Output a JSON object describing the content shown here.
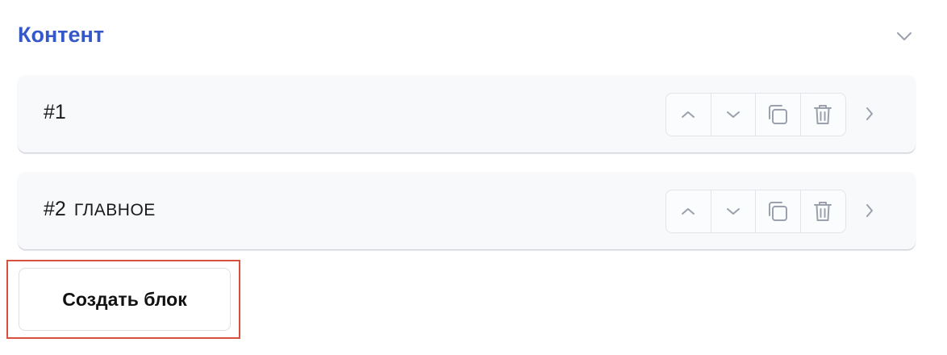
{
  "section": {
    "title": "Контент",
    "toggle_icon": "chevron-down-icon"
  },
  "blocks": [
    {
      "number": "#1",
      "title": "",
      "actions": [
        "move-up-icon",
        "move-down-icon",
        "duplicate-icon",
        "delete-icon"
      ],
      "expand_icon": "chevron-right-icon"
    },
    {
      "number": "#2",
      "title": "Главное",
      "actions": [
        "move-up-icon",
        "move-down-icon",
        "duplicate-icon",
        "delete-icon"
      ],
      "expand_icon": "chevron-right-icon"
    }
  ],
  "create_button": {
    "label": "Создать блок"
  },
  "colors": {
    "title_accent": "#3457c9",
    "row_background": "#f8f9fb",
    "icon_gray": "#9aa1ad",
    "highlight_border": "#d9503d"
  }
}
